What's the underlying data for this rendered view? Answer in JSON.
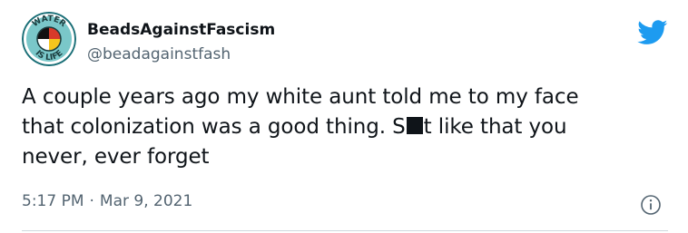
{
  "author": {
    "display_name": "BeadsAgainstFascism",
    "handle": "@beadagainstfash",
    "avatar_text_top": "WATER",
    "avatar_text_bottom": "IS LIFE"
  },
  "tweet": {
    "lines": [
      {
        "text": "A couple years ago my white aunt told me to my face"
      },
      {
        "text": "that colonization was a good thing. S",
        "after": "t like that you"
      },
      {
        "text": "never, ever forget"
      }
    ]
  },
  "meta": {
    "time": "5:17 PM",
    "separator": "·",
    "date": "Mar 9, 2021"
  },
  "icons": {
    "brand": "twitter-bird-icon",
    "info": "info-icon"
  },
  "colors": {
    "brand_blue": "#1d9bf0",
    "text_primary": "#0f1419",
    "text_secondary": "#536471",
    "divider": "#cfd9de"
  }
}
